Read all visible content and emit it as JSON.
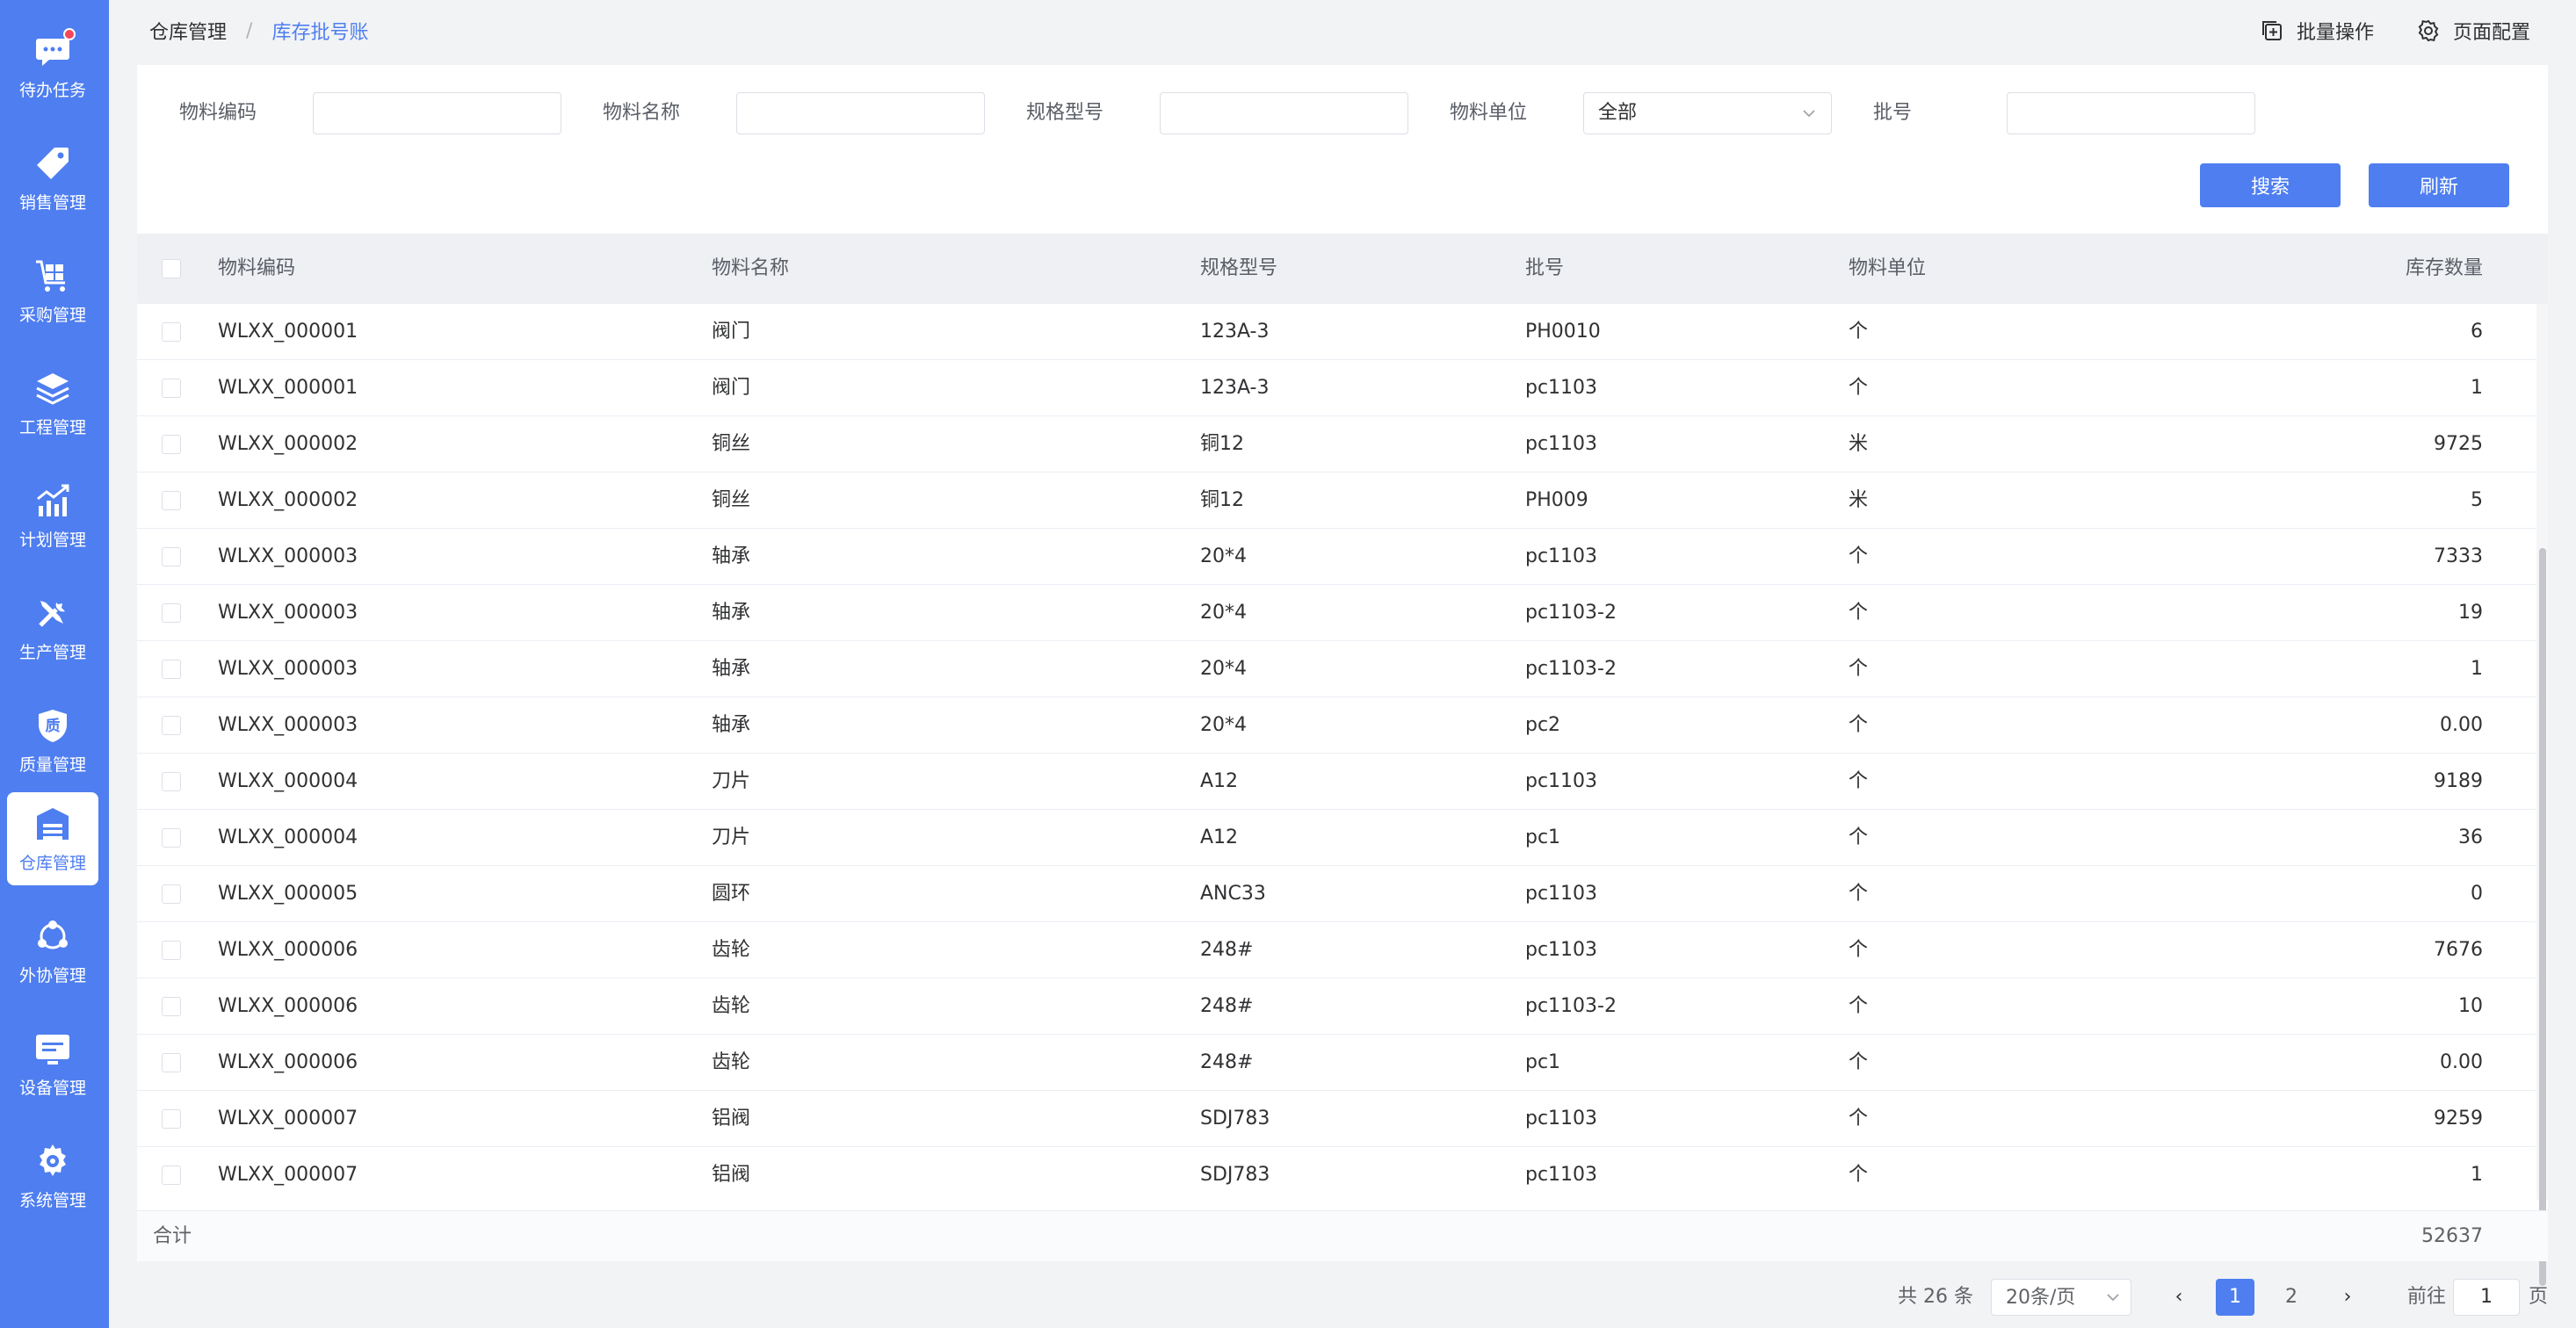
{
  "sidebar": {
    "items": [
      {
        "label": "待办任务",
        "icon": "chat-icon",
        "badge": true
      },
      {
        "label": "销售管理",
        "icon": "tag-icon"
      },
      {
        "label": "采购管理",
        "icon": "cart-icon"
      },
      {
        "label": "工程管理",
        "icon": "layers-icon"
      },
      {
        "label": "计划管理",
        "icon": "chart-icon"
      },
      {
        "label": "生产管理",
        "icon": "tools-icon"
      },
      {
        "label": "质量管理",
        "icon": "shield-icon",
        "glyph": "质"
      },
      {
        "label": "仓库管理",
        "icon": "warehouse-icon",
        "active": true
      },
      {
        "label": "外协管理",
        "icon": "network-icon"
      },
      {
        "label": "设备管理",
        "icon": "device-icon"
      },
      {
        "label": "系统管理",
        "icon": "gear-icon"
      }
    ]
  },
  "header": {
    "breadcrumb_root": "仓库管理",
    "breadcrumb_sep": "/",
    "breadcrumb_current": "库存批号账",
    "batch_label": "批量操作",
    "config_label": "页面配置"
  },
  "filters": {
    "code_label": "物料编码",
    "code_value": "",
    "name_label": "物料名称",
    "name_value": "",
    "spec_label": "规格型号",
    "spec_value": "",
    "unit_label": "物料单位",
    "unit_value": "全部",
    "batch_label": "批号",
    "batch_value": "",
    "search_btn": "搜索",
    "refresh_btn": "刷新"
  },
  "table": {
    "headers": {
      "code": "物料编码",
      "name": "物料名称",
      "spec": "规格型号",
      "batch": "批号",
      "unit": "物料单位",
      "qty": "库存数量"
    },
    "rows": [
      {
        "code": "WLXX_000001",
        "name": "阀门",
        "spec": "123A-3",
        "batch": "PH0010",
        "unit": "个",
        "qty": "6"
      },
      {
        "code": "WLXX_000001",
        "name": "阀门",
        "spec": "123A-3",
        "batch": "pc1103",
        "unit": "个",
        "qty": "1"
      },
      {
        "code": "WLXX_000002",
        "name": "铜丝",
        "spec": "铜12",
        "batch": "pc1103",
        "unit": "米",
        "qty": "9725"
      },
      {
        "code": "WLXX_000002",
        "name": "铜丝",
        "spec": "铜12",
        "batch": "PH009",
        "unit": "米",
        "qty": "5"
      },
      {
        "code": "WLXX_000003",
        "name": "轴承",
        "spec": "20*4",
        "batch": "pc1103",
        "unit": "个",
        "qty": "7333"
      },
      {
        "code": "WLXX_000003",
        "name": "轴承",
        "spec": "20*4",
        "batch": "pc1103-2",
        "unit": "个",
        "qty": "19"
      },
      {
        "code": "WLXX_000003",
        "name": "轴承",
        "spec": "20*4",
        "batch": "pc1103-2",
        "unit": "个",
        "qty": "1"
      },
      {
        "code": "WLXX_000003",
        "name": "轴承",
        "spec": "20*4",
        "batch": "pc2",
        "unit": "个",
        "qty": "0.00"
      },
      {
        "code": "WLXX_000004",
        "name": "刀片",
        "spec": "A12",
        "batch": "pc1103",
        "unit": "个",
        "qty": "9189"
      },
      {
        "code": "WLXX_000004",
        "name": "刀片",
        "spec": "A12",
        "batch": "pc1",
        "unit": "个",
        "qty": "36"
      },
      {
        "code": "WLXX_000005",
        "name": "圆环",
        "spec": "ANC33",
        "batch": "pc1103",
        "unit": "个",
        "qty": "0"
      },
      {
        "code": "WLXX_000006",
        "name": "齿轮",
        "spec": "248#",
        "batch": "pc1103",
        "unit": "个",
        "qty": "7676"
      },
      {
        "code": "WLXX_000006",
        "name": "齿轮",
        "spec": "248#",
        "batch": "pc1103-2",
        "unit": "个",
        "qty": "10"
      },
      {
        "code": "WLXX_000006",
        "name": "齿轮",
        "spec": "248#",
        "batch": "pc1",
        "unit": "个",
        "qty": "0.00"
      },
      {
        "code": "WLXX_000007",
        "name": "铝阀",
        "spec": "SDJ783",
        "batch": "pc1103",
        "unit": "个",
        "qty": "9259"
      },
      {
        "code": "WLXX_000007",
        "name": "铝阀",
        "spec": "SDJ783",
        "batch": "pc1103",
        "unit": "个",
        "qty": "1"
      }
    ],
    "total_label": "合计",
    "total_value": "52637"
  },
  "pagination": {
    "total_text": "共 26 条",
    "page_size": "20条/页",
    "prev": "‹",
    "next": "›",
    "pages": [
      "1",
      "2"
    ],
    "current_page": "1",
    "goto_label": "前往",
    "goto_value": "1",
    "goto_suffix": "页"
  },
  "colors": {
    "primary": "#4e7ef0",
    "sidebar": "#4e7ef0",
    "badge": "#f5465a"
  }
}
